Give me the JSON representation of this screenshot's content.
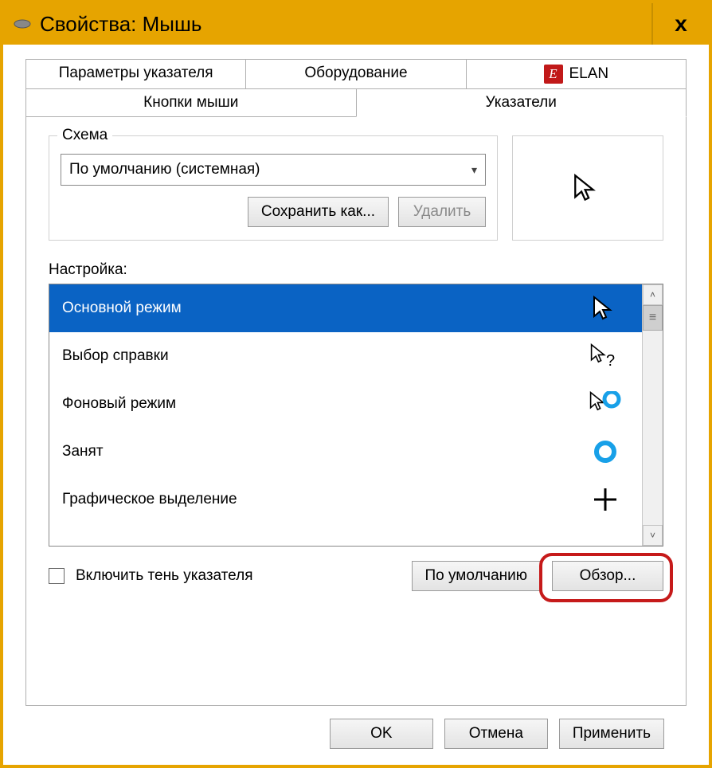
{
  "window": {
    "title": "Свойства: Мышь",
    "close_glyph": "x"
  },
  "tabs": {
    "row1": [
      {
        "label": "Параметры указателя"
      },
      {
        "label": "Оборудование"
      },
      {
        "label": "ELAN",
        "badge": "E"
      }
    ],
    "row2": [
      {
        "label": "Кнопки мыши"
      },
      {
        "label": "Указатели",
        "active": true
      }
    ]
  },
  "scheme": {
    "legend": "Схема",
    "selected": "По умолчанию (системная)",
    "save_as": "Сохранить как...",
    "delete": "Удалить"
  },
  "customize": {
    "label": "Настройка:",
    "items": [
      {
        "label": "Основной режим",
        "cursor": "arrow",
        "selected": true
      },
      {
        "label": "Выбор справки",
        "cursor": "help"
      },
      {
        "label": "Фоновый режим",
        "cursor": "working"
      },
      {
        "label": "Занят",
        "cursor": "busy"
      },
      {
        "label": "Графическое выделение",
        "cursor": "cross"
      }
    ]
  },
  "options": {
    "shadow_label": "Включить тень указателя",
    "default_btn": "По умолчанию",
    "browse_btn": "Обзор..."
  },
  "dialog": {
    "ok": "OK",
    "cancel": "Отмена",
    "apply": "Применить"
  },
  "scroll": {
    "up": "˄",
    "down": "˅",
    "thumb": "≡"
  }
}
